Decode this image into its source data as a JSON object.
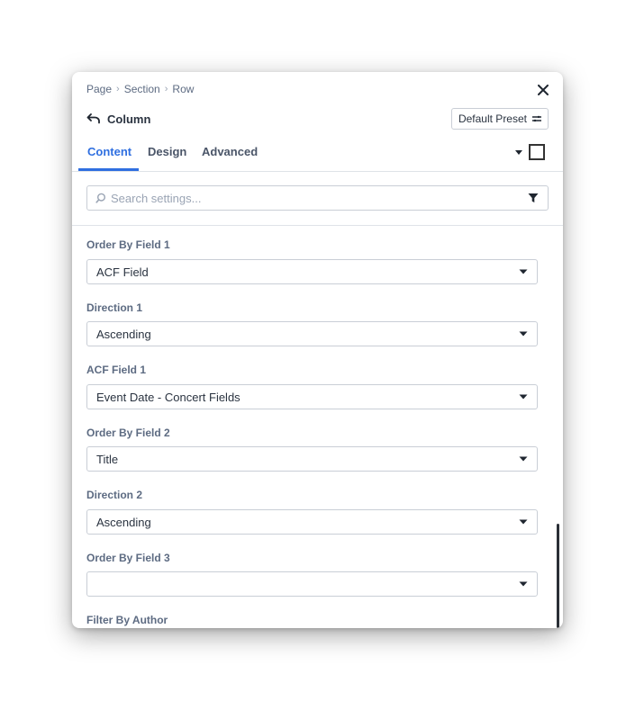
{
  "breadcrumb": [
    "Page",
    "Section",
    "Row"
  ],
  "header": {
    "title": "Column",
    "preset_label": "Default Preset"
  },
  "tabs": [
    {
      "label": "Content",
      "active": true
    },
    {
      "label": "Design",
      "active": false
    },
    {
      "label": "Advanced",
      "active": false
    }
  ],
  "search": {
    "placeholder": "Search settings...",
    "value": ""
  },
  "fields": [
    {
      "label": "Order By Field 1",
      "value": "ACF Field"
    },
    {
      "label": "Direction 1",
      "value": "Ascending"
    },
    {
      "label": "ACF Field 1",
      "value": "Event Date - Concert Fields"
    },
    {
      "label": "Order By Field 2",
      "value": "Title"
    },
    {
      "label": "Direction 2",
      "value": "Ascending"
    },
    {
      "label": "Order By Field 3",
      "value": ""
    }
  ],
  "trailing_label": "Filter By Author",
  "colors": {
    "accent": "#2f6fe0",
    "label": "#5d6b82",
    "text": "#2a3340",
    "border": "#c9ced6"
  },
  "icons": {
    "close": "close-icon",
    "back": "undo-arrow-icon",
    "preset": "preset-settings-icon",
    "search": "search-icon",
    "filter": "filter-icon",
    "select_caret": "caret-down-icon"
  }
}
